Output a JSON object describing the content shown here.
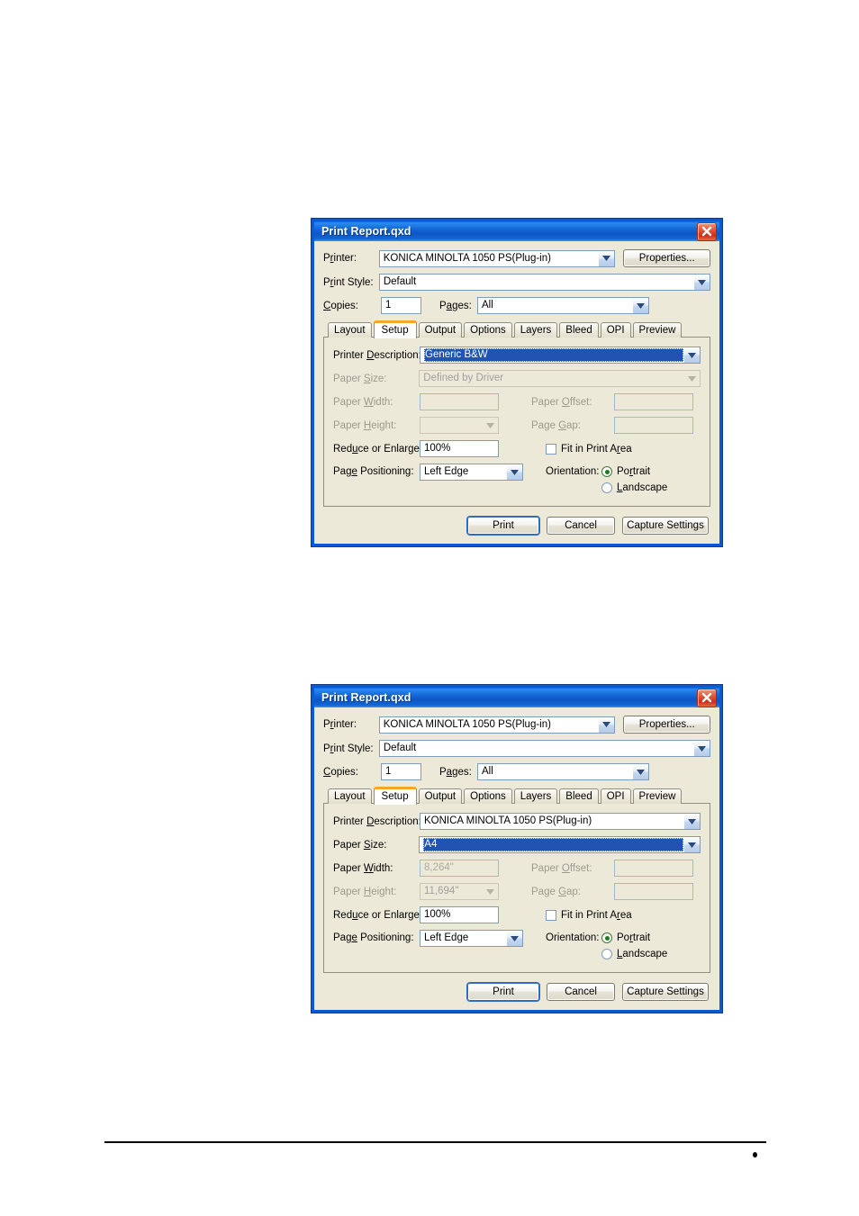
{
  "page": {
    "footer_bullet": "•"
  },
  "dialogs": [
    {
      "id": "dialog-generic-bw",
      "title": "Print Report.qxd",
      "close_label": "×",
      "fields": {
        "printer_label": "Printer:",
        "printer_value": "KONICA MINOLTA 1050 PS(Plug-in)",
        "properties_label": "Properties...",
        "print_style_label": "Print Style:",
        "print_style_value": "Default",
        "copies_label": "Copies:",
        "copies_value": "1",
        "pages_label": "Pages:",
        "pages_value": "All"
      },
      "tabs": [
        {
          "label": "Layout",
          "active": false
        },
        {
          "label": "Setup",
          "active": true
        },
        {
          "label": "Output",
          "active": false
        },
        {
          "label": "Options",
          "active": false
        },
        {
          "label": "Layers",
          "active": false
        },
        {
          "label": "Bleed",
          "active": false
        },
        {
          "label": "OPI",
          "active": false
        },
        {
          "label": "Preview",
          "active": false
        }
      ],
      "setup": {
        "printer_description_label": "Printer Description:",
        "printer_description_value": "Generic B&W",
        "printer_description_selected": true,
        "paper_size_label": "Paper Size:",
        "paper_size_value": "Defined by Driver",
        "paper_size_disabled": true,
        "paper_width_label": "Paper Width:",
        "paper_width_value": "",
        "paper_offset_label": "Paper Offset:",
        "paper_offset_value": "",
        "paper_height_label": "Paper Height:",
        "paper_height_value": "",
        "page_gap_label": "Page Gap:",
        "page_gap_value": "",
        "reduce_label": "Reduce or Enlarge:",
        "reduce_value": "100%",
        "fit_label": "Fit in Print Area",
        "fit_checked": false,
        "page_positioning_label": "Page Positioning:",
        "page_positioning_value": "Left Edge",
        "orientation_label": "Orientation:",
        "orientation_portrait": "Portrait",
        "orientation_landscape": "Landscape",
        "orientation_selected": "Portrait"
      },
      "buttons": {
        "print": "Print",
        "cancel": "Cancel",
        "capture": "Capture Settings"
      }
    },
    {
      "id": "dialog-a4",
      "title": "Print Report.qxd",
      "close_label": "×",
      "fields": {
        "printer_label": "Printer:",
        "printer_value": "KONICA MINOLTA 1050 PS(Plug-in)",
        "properties_label": "Properties...",
        "print_style_label": "Print Style:",
        "print_style_value": "Default",
        "copies_label": "Copies:",
        "copies_value": "1",
        "pages_label": "Pages:",
        "pages_value": "All"
      },
      "tabs": [
        {
          "label": "Layout",
          "active": false
        },
        {
          "label": "Setup",
          "active": true
        },
        {
          "label": "Output",
          "active": false
        },
        {
          "label": "Options",
          "active": false
        },
        {
          "label": "Layers",
          "active": false
        },
        {
          "label": "Bleed",
          "active": false
        },
        {
          "label": "OPI",
          "active": false
        },
        {
          "label": "Preview",
          "active": false
        }
      ],
      "setup": {
        "printer_description_label": "Printer Description:",
        "printer_description_value": "KONICA MINOLTA 1050 PS(Plug-in)",
        "printer_description_selected": false,
        "paper_size_label": "Paper Size:",
        "paper_size_value": "A4",
        "paper_size_disabled": false,
        "paper_width_label": "Paper Width:",
        "paper_width_value": "8,264\"",
        "paper_offset_label": "Paper Offset:",
        "paper_offset_value": "",
        "paper_height_label": "Paper Height:",
        "paper_height_value": "11,694\"",
        "page_gap_label": "Page Gap:",
        "page_gap_value": "",
        "reduce_label": "Reduce or Enlarge:",
        "reduce_value": "100%",
        "fit_label": "Fit in Print Area",
        "fit_checked": false,
        "page_positioning_label": "Page Positioning:",
        "page_positioning_value": "Left Edge",
        "orientation_label": "Orientation:",
        "orientation_portrait": "Portrait",
        "orientation_landscape": "Landscape",
        "orientation_selected": "Portrait"
      },
      "buttons": {
        "print": "Print",
        "cancel": "Cancel",
        "capture": "Capture Settings"
      }
    }
  ],
  "colors": {
    "title_blue": "#0a5ad6",
    "dialog_face": "#ece9d8",
    "active_tab_accent": "#f5a623",
    "selection_blue": "#2053b2",
    "close_red": "#c9301a",
    "radio_green": "#1d7a1d"
  }
}
